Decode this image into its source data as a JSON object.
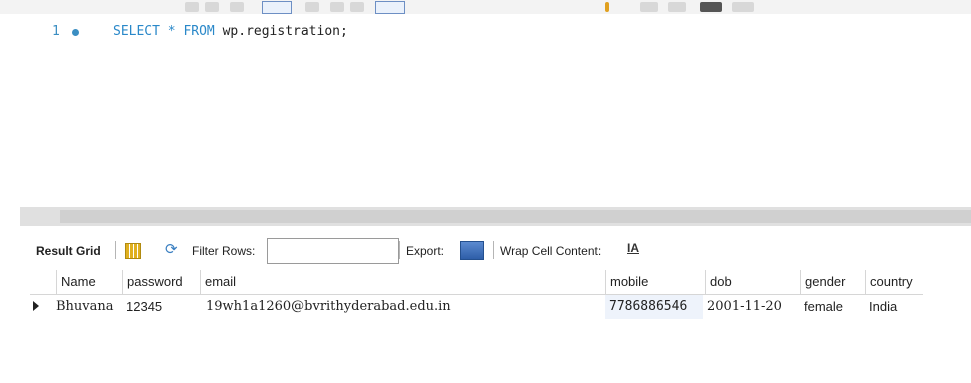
{
  "editor": {
    "line_number": "1",
    "kw_select": "SELECT",
    "star": " * ",
    "kw_from": "FROM",
    "table_ref": " wp.registration;"
  },
  "scroll": {
    "left_arrow": "<"
  },
  "result_toolbar": {
    "result_grid": "Result Grid",
    "filter_rows": "Filter Rows:",
    "filter_value": "",
    "export": "Export:",
    "wrap_cell_content": "Wrap Cell Content:",
    "wrap_icon": "IA"
  },
  "grid": {
    "columns": [
      "Name",
      "password",
      "email",
      "mobile",
      "dob",
      "gender",
      "country"
    ],
    "rows": [
      [
        "Bhuvana",
        "12345",
        "19wh1a1260@bvrithyderabad.edu.in",
        "7786886546",
        "2001-11-20",
        "female",
        "India"
      ]
    ]
  },
  "icons": {
    "grid": "grid-icon",
    "refresh": "refresh-icon",
    "export": "export-icon",
    "wrap": "wrap-text-icon",
    "row_marker": "row-marker-icon"
  }
}
